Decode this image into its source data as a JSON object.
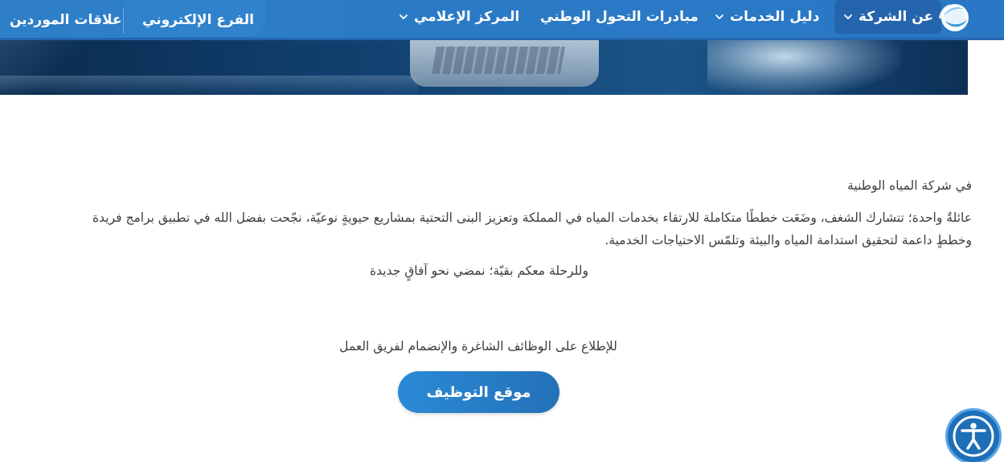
{
  "nav": {
    "items": [
      {
        "label": "عن الشركة",
        "has_dropdown": true,
        "active": true
      },
      {
        "label": "دليل الخدمات",
        "has_dropdown": true,
        "active": false
      },
      {
        "label": "مبادرات التحول الوطني",
        "has_dropdown": false,
        "active": false
      },
      {
        "label": "المركز الإعلامي",
        "has_dropdown": true,
        "active": false
      }
    ],
    "links": {
      "eportal": "الفرع الإلكتروني",
      "suppliers": "علاقات الموردين"
    }
  },
  "content": {
    "intro": "في شركة المياه الوطنية",
    "line1": "عائلةٌ واحدة؛ تتشارك الشغف، وضَعَت خططًا متكاملة للارتقاء بخدمات المياه في المملكة وتعزيز البنى التحتية بمشاريع حيويةٍ نوعيّة، نجّحت بفضل الله في تطبيق برامج فريدة",
    "line2": "وخططٍ داعمة لتحقيق استدامة المياه والبيئة وتلمّس الاحتياجات الخدمية.",
    "line3": "وللرحلة معكم بقيّة؛ نمضي نحو آفاقٍ جديدة",
    "jobs_text": "للإطلاع على الوظائف الشاغرة والإنضمام لفريق العمل",
    "cta_label": "موقع التوظيف"
  },
  "colors": {
    "nav_bg": "#2b7ac6",
    "nav_active": "#2565ad",
    "cta_start": "#2a8ad6",
    "cta_end": "#2471b8",
    "a11y_bg": "#1e6fb8"
  },
  "icons": {
    "logo": "company-logo",
    "dropdown": "chevron-down-icon",
    "accessibility": "accessibility-icon"
  }
}
